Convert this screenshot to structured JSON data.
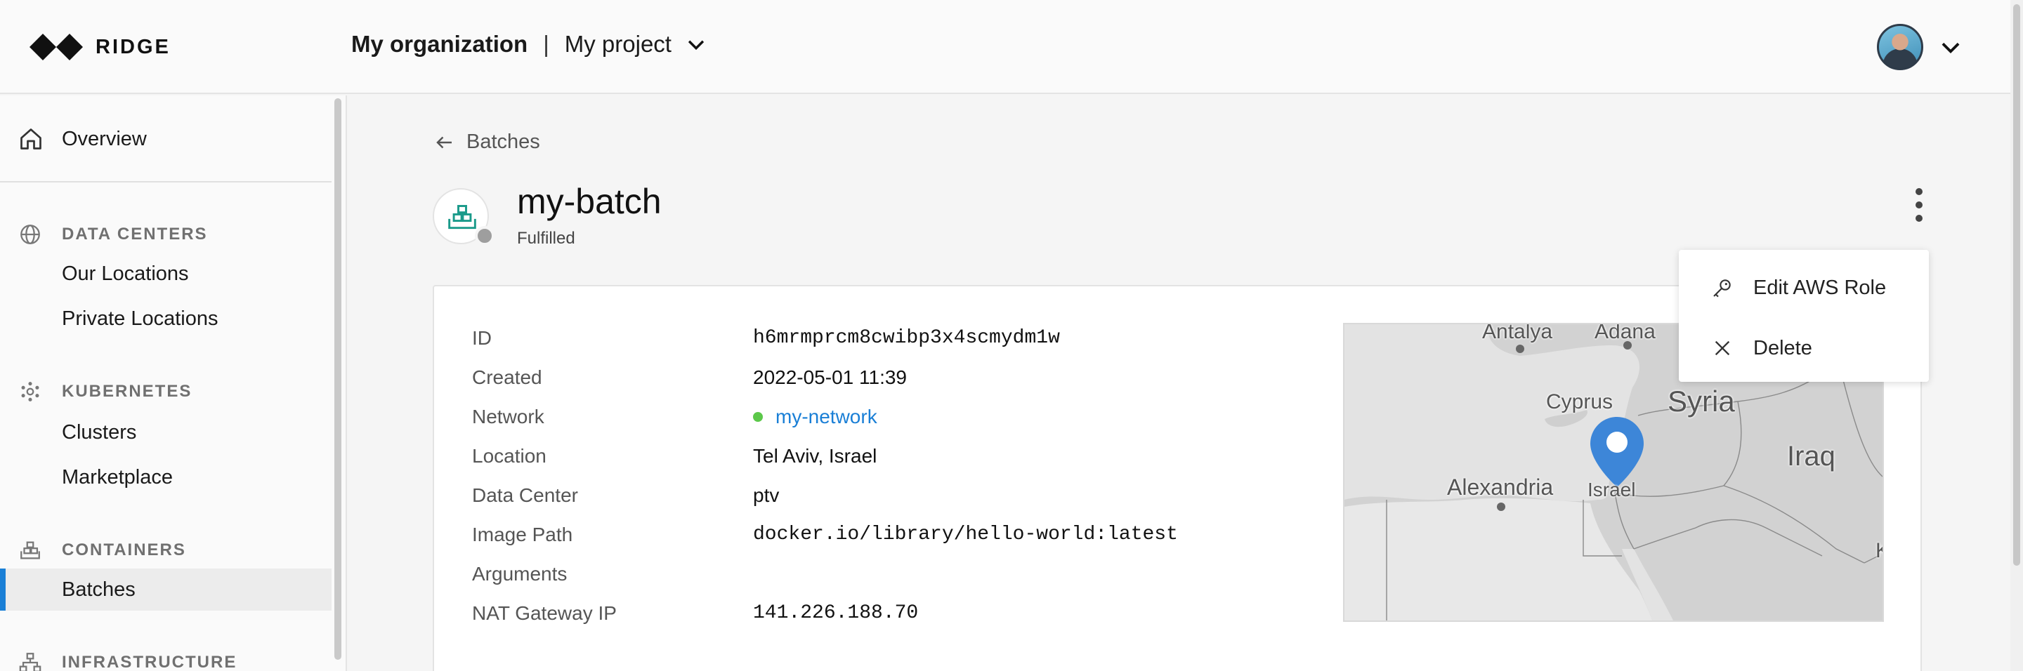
{
  "header": {
    "logo_text": "RIDGE",
    "organization": "My organization",
    "separator": "|",
    "project": "My project"
  },
  "sidebar": {
    "overview": "Overview",
    "sections": [
      {
        "title": "DATA CENTERS",
        "icon": "globe-icon",
        "items": [
          "Our Locations",
          "Private Locations"
        ]
      },
      {
        "title": "KUBERNETES",
        "icon": "kubernetes-icon",
        "items": [
          "Clusters",
          "Marketplace"
        ]
      },
      {
        "title": "CONTAINERS",
        "icon": "containers-icon",
        "items": [
          "Batches"
        ]
      },
      {
        "title": "INFRASTRUCTURE",
        "icon": "infrastructure-icon",
        "items": []
      }
    ],
    "active_item": "Batches"
  },
  "breadcrumb": {
    "back_label": "Batches"
  },
  "batch": {
    "name": "my-batch",
    "status": "Fulfilled",
    "status_color": "#9e9e9e"
  },
  "details": {
    "fields": [
      {
        "key": "ID",
        "value": "h6mrmprcm8cwibp3x4scmydm1w"
      },
      {
        "key": "Created",
        "value": "2022-05-01 11:39"
      },
      {
        "key": "Network",
        "value": "my-network"
      },
      {
        "key": "Location",
        "value": "Tel Aviv, Israel"
      },
      {
        "key": "Data Center",
        "value": "ptv"
      },
      {
        "key": "Image Path",
        "value": "docker.io/library/hello-world:latest"
      },
      {
        "key": "Arguments",
        "value": ""
      },
      {
        "key": "NAT Gateway IP",
        "value": "141.226.188.70"
      }
    ],
    "network_status_color": "#5cc84a",
    "link_color": "#1a7fd6"
  },
  "map": {
    "labels": [
      "Antalya",
      "Adana",
      "Cyprus",
      "Syria",
      "Iraq",
      "Alexandria",
      "Israel",
      "K"
    ]
  },
  "menu": {
    "items": [
      {
        "label": "Edit AWS Role",
        "icon": "key-icon"
      },
      {
        "label": "Delete",
        "icon": "close-icon"
      }
    ]
  },
  "colors": {
    "accent": "#1a7fd6",
    "marker": "#3d86d8"
  }
}
